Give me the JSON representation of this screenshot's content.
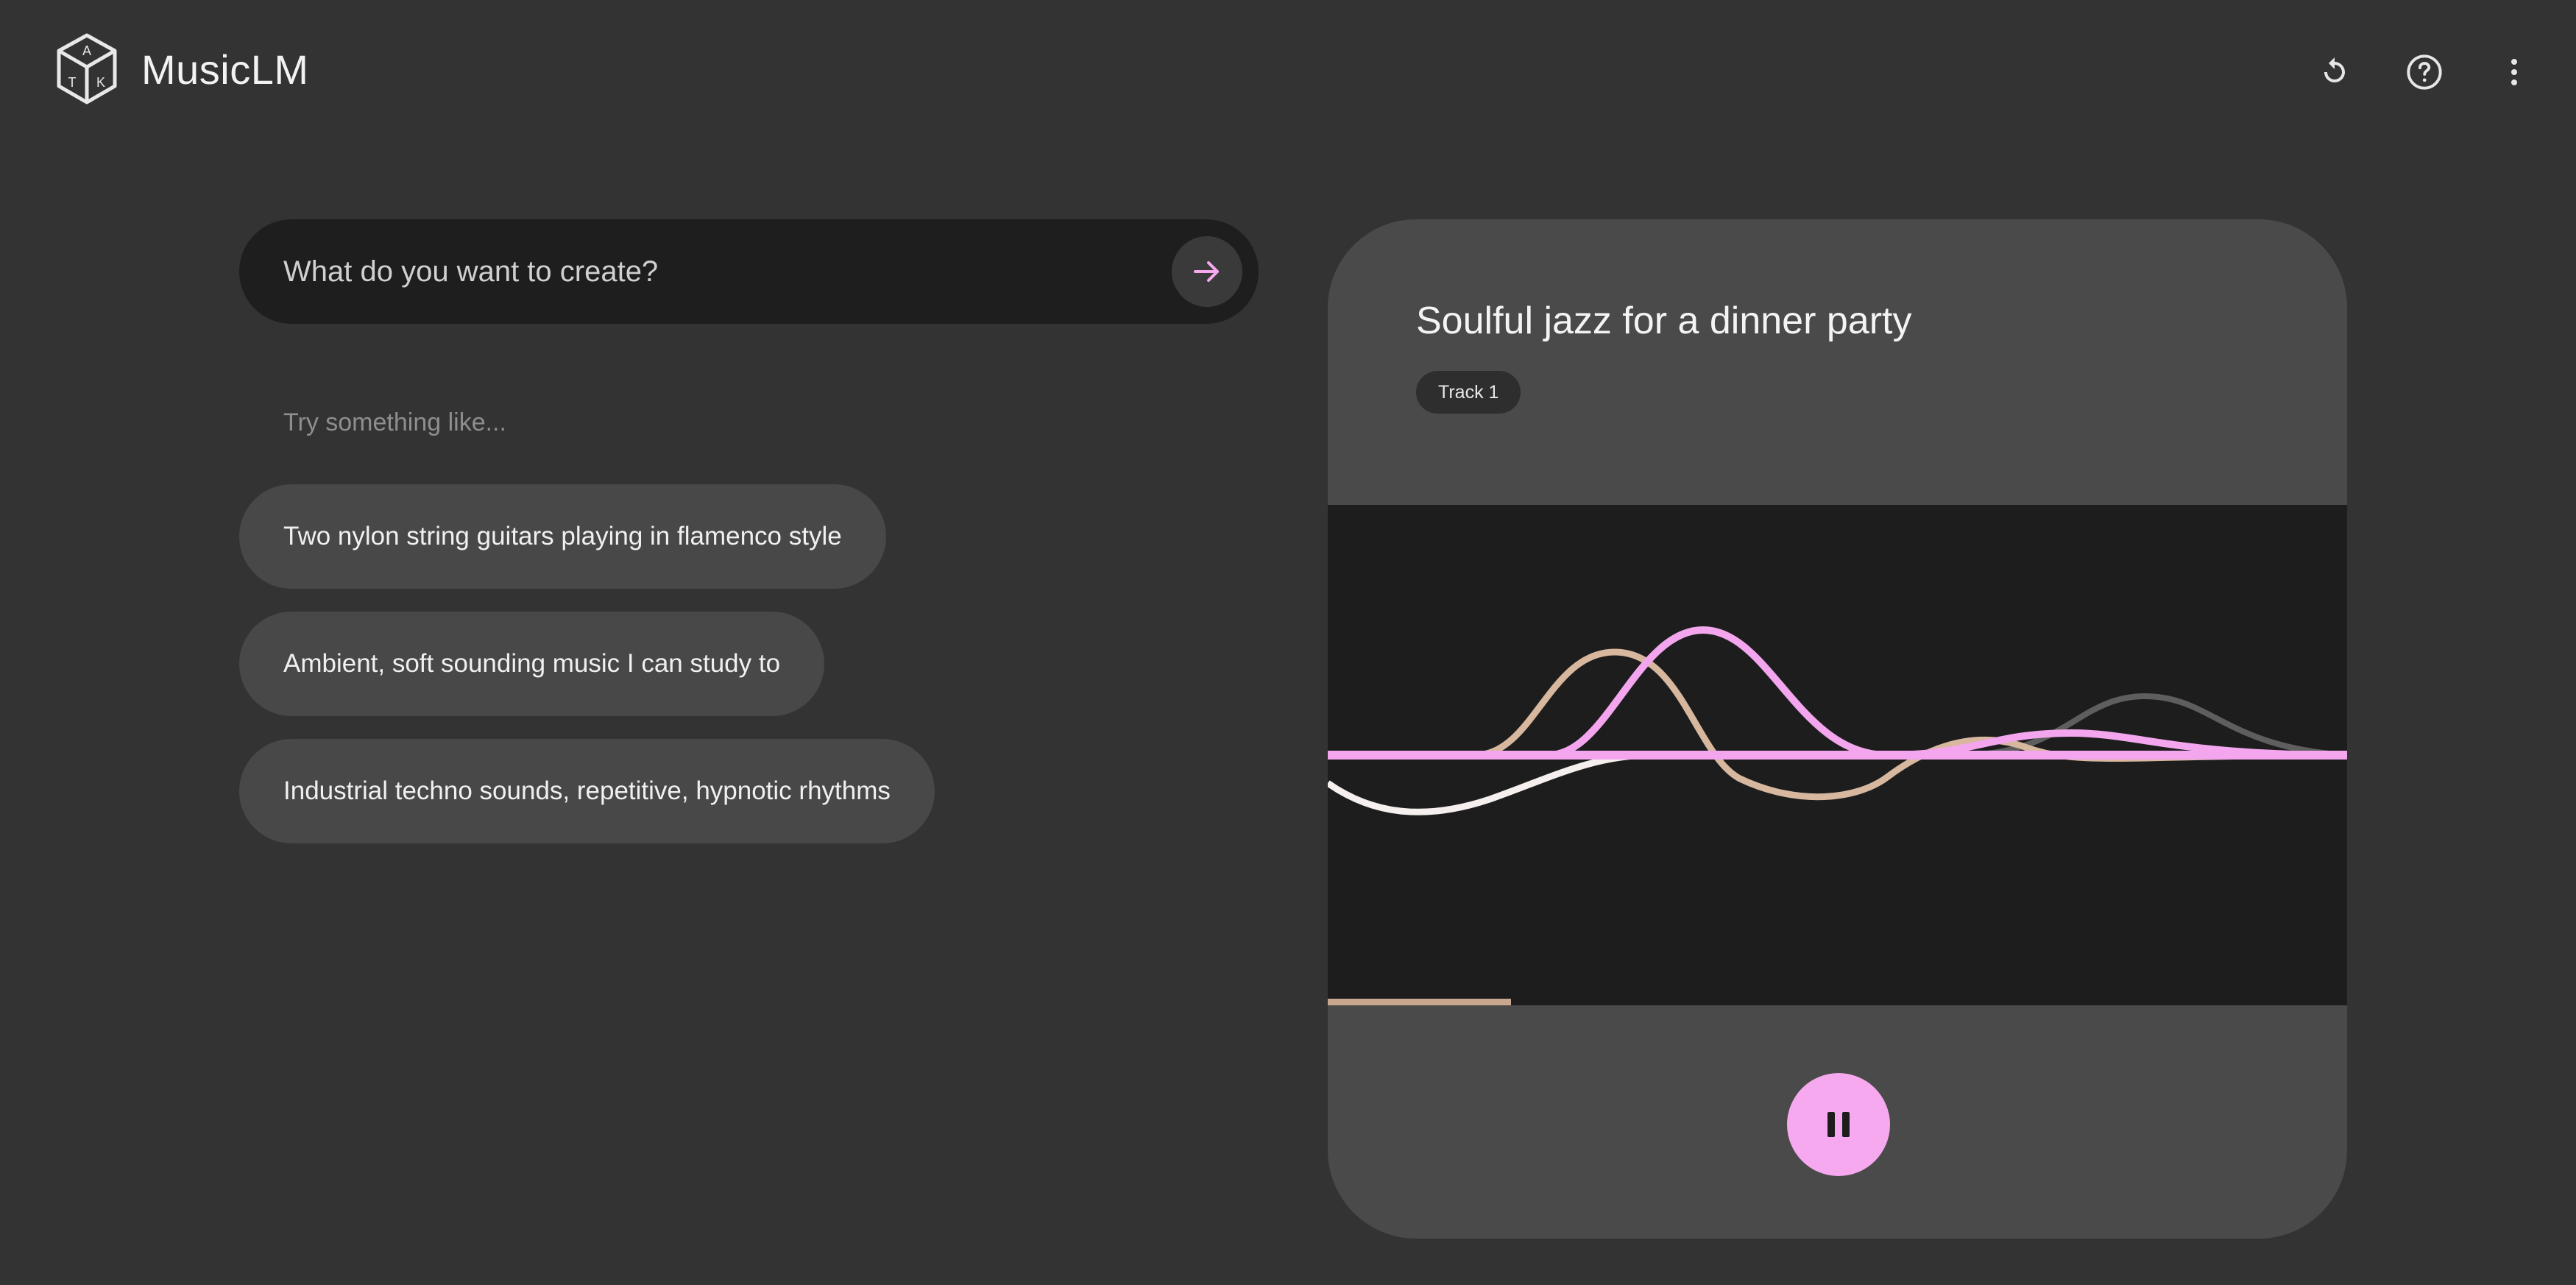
{
  "app": {
    "title": "MusicLM"
  },
  "header": {
    "icons": [
      "logo-icon",
      "reset-icon",
      "help-icon",
      "more-vert-icon"
    ]
  },
  "prompt": {
    "placeholder": "What do you want to create?",
    "submit_icon": "arrow-right-icon"
  },
  "suggestions": {
    "heading": "Try something like...",
    "items": [
      "Two nylon string guitars playing in flamenco style",
      "Ambient, soft sounding music I can study to",
      "Industrial techno sounds, repetitive, hypnotic rhythms"
    ]
  },
  "player": {
    "title": "Soulful jazz for a dinner party",
    "badge": "Track 1",
    "progress": 0.18,
    "control_icon": "pause-icon",
    "colors": {
      "accent": "#f7a9f0",
      "tan": "#d7b79e",
      "white": "#f5f0ee",
      "grey": "#6a6a6a"
    }
  }
}
